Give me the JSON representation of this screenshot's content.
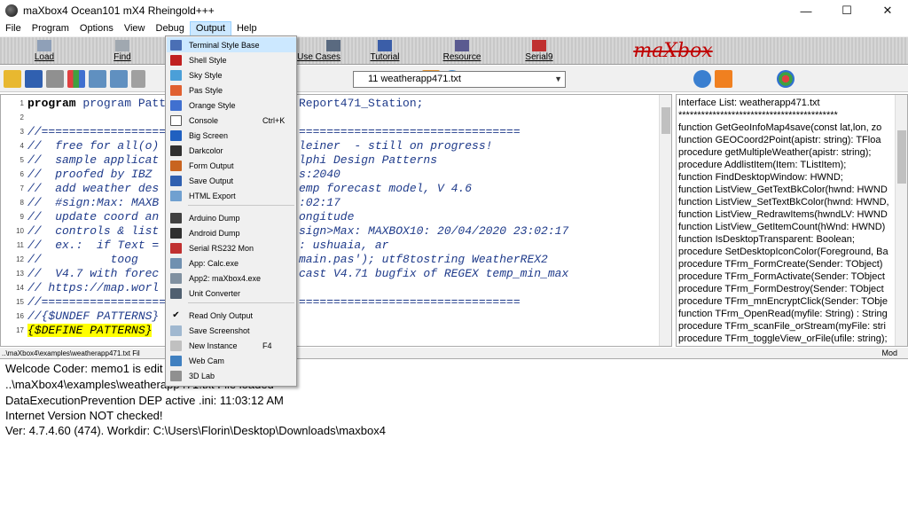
{
  "window": {
    "title": "maXbox4 Ocean101 mX4 Rheingold+++",
    "minimize": "—",
    "maximize": "☐",
    "close": "✕"
  },
  "menu": [
    "File",
    "Program",
    "Options",
    "View",
    "Debug",
    "Output",
    "Help"
  ],
  "toolbar1": {
    "load": "Load",
    "find": "Find",
    "use_cases": "Use Cases",
    "tutorial": "Tutorial",
    "resource": "Resource",
    "serial": "Serial9",
    "logo": "maXbox"
  },
  "file_combo": {
    "value": "11   weatherapp471.txt"
  },
  "output_menu": {
    "items": [
      {
        "label": "Terminal Style Base",
        "shortcut": "",
        "color": "#4a6fb5"
      },
      {
        "label": "Shell Style",
        "shortcut": "",
        "color": "#c02020"
      },
      {
        "label": "Sky Style",
        "shortcut": "",
        "color": "#4b9fd8"
      },
      {
        "label": "Pas Style",
        "shortcut": "",
        "color": "#e06030"
      },
      {
        "label": "Orange Style",
        "shortcut": "",
        "color": "#4070d0"
      },
      {
        "label": "Console",
        "shortcut": "Ctrl+K",
        "color": "#ffffff"
      },
      {
        "label": "Big Screen",
        "shortcut": "",
        "color": "#2060c0"
      },
      {
        "label": "Darkcolor",
        "shortcut": "",
        "color": "#303030"
      },
      {
        "label": "Form Output",
        "shortcut": "",
        "color": "#c86420"
      },
      {
        "label": "Save Output",
        "shortcut": "",
        "color": "#3060b0"
      },
      {
        "label": "HTML Export",
        "shortcut": "",
        "color": "#70a0d0"
      },
      {
        "label": "Arduino Dump",
        "shortcut": "",
        "color": "#404040"
      },
      {
        "label": "Android Dump",
        "shortcut": "",
        "color": "#303030"
      },
      {
        "label": "Serial RS232 Mon",
        "shortcut": "",
        "color": "#c03030"
      },
      {
        "label": "App: Calc.exe",
        "shortcut": "",
        "color": "#7090b0"
      },
      {
        "label": "App2: maXbox4.exe",
        "shortcut": "",
        "color": "#8090a0"
      },
      {
        "label": "Unit Converter",
        "shortcut": "",
        "color": "#506070"
      },
      {
        "label": "Read Only Output",
        "shortcut": "",
        "checked": "✔"
      },
      {
        "label": "Save Screenshot",
        "shortcut": "",
        "color": "#a0b8d0"
      },
      {
        "label": "New Instance",
        "shortcut": "F4",
        "color": "#c0c0c0"
      },
      {
        "label": "Web Cam",
        "shortcut": "",
        "color": "#4080c0"
      },
      {
        "label": "3D Lab",
        "shortcut": "",
        "color": "#909090"
      }
    ]
  },
  "editor": {
    "lines": [
      {
        "n": "1",
        "text": "program PatternFrmD",
        "tail": "Report471_Station;"
      },
      {
        "n": "2",
        "text": "",
        "tail": ""
      },
      {
        "n": "3",
        "text": "//==================",
        "tail": "================================"
      },
      {
        "n": "4",
        "text": "//  free for all(o)",
        "tail": "leiner  - still on progress!"
      },
      {
        "n": "5",
        "text": "//  sample applicat",
        "tail": "lphi Design Patterns"
      },
      {
        "n": "6",
        "text": "//  proofed by IBZ ",
        "tail": "s:2040"
      },
      {
        "n": "7",
        "text": "//  add weather des",
        "tail": "emp forecast model, V 4.6"
      },
      {
        "n": "8",
        "text": "//  #sign:Max: MAXB",
        "tail": ":02:17"
      },
      {
        "n": "9",
        "text": "//  update coord an",
        "tail": "ongitude"
      },
      {
        "n": "10",
        "text": "//  controls & list",
        "tail": "sign>Max: MAXBOX10: 20/04/2020 23:02:17"
      },
      {
        "n": "11",
        "text": "//  ex.:  if Text =",
        "tail": ": ushuaia, ar"
      },
      {
        "n": "12",
        "text": "//          toog",
        "tail": "main.pas'); utf8tostring WeatherREX2"
      },
      {
        "n": "13",
        "text": "//  V4.7 with forec",
        "tail": "cast V4.71 bugfix of REGEX temp_min_max"
      },
      {
        "n": "14",
        "text": "// https://map.worl",
        "tail": ""
      },
      {
        "n": "15",
        "text": "//==================",
        "tail": "================================"
      },
      {
        "n": "16",
        "text": "//{$UNDEF PATTERNS}",
        "tail": ""
      },
      {
        "n": "17",
        "text": "{$DEFINE PATTERNS}",
        "tail": ""
      }
    ]
  },
  "interface_list": {
    "title": "Interface List: weatherapp471.txt",
    "lines": [
      "******************************************",
      " function GetGeoInfoMap4save(const lat,lon, zo",
      "  function GEOCoord2Point(apistr: string): TFloa",
      "  procedure getMultipleWeather(apistr: string);",
      "procedure AddlistItem(Item: TListItem);",
      " function FindDesktopWindow: HWND;",
      "function ListView_GetTextBkColor(hwnd: HWND",
      "function ListView_SetTextBkColor(hwnd: HWND,",
      "function ListView_RedrawItems(hwndLV: HWND",
      "function ListView_GetItemCount(hWnd: HWND)",
      "function IsDesktopTransparent: Boolean;",
      "procedure SetDesktopIconColor(Foreground, Ba",
      "procedure TFrm_FormCreate(Sender: TObject)",
      "procedure TFrm_FormActivate(Sender: TObject",
      "procedure TFrm_FormDestroy(Sender: TObject",
      "procedure TFrm_mnEncryptClick(Sender: TObje",
      "function TFrm_OpenRead(myfile: String) : String",
      "procedure TFrm_scanFile_orStream(myFile: stri",
      "procedure TFrm_toggleView_orFile(ufile: string);"
    ]
  },
  "statusbar": {
    "left": "..\\maXbox4\\examples\\weatherapp471.txt Fil",
    "right": "Mod"
  },
  "memo": {
    "lines": [
      "Welcode Coder: memo1 is edit",
      "..\\maXbox4\\examples\\weatherapp471.txt File loaded",
      "DataExecutionPrevention DEP active .ini: 11:03:12 AM",
      "Internet Version NOT checked!",
      "Ver: 4.7.4.60 (474). Workdir: C:\\Users\\Florin\\Desktop\\Downloads\\maxbox4"
    ]
  }
}
